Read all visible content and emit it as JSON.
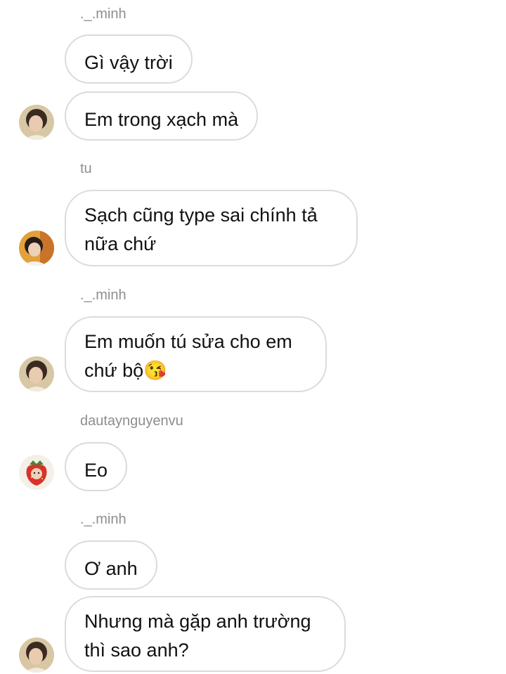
{
  "thread": {
    "messages": [
      {
        "sender": "._.minh",
        "text": "Gì vậy trời"
      },
      {
        "text": "Em trong xạch mà"
      },
      {
        "sender": "tu",
        "text": "Sạch cũng type sai chính tả nữa chứ"
      },
      {
        "sender": "._.minh",
        "text": "Em muốn tú sửa cho em chứ bộ😘"
      },
      {
        "sender": "dautaynguyenvu",
        "text": "Eo"
      },
      {
        "sender": "._.minh",
        "text": "Ơ anh"
      },
      {
        "text": "Nhưng mà gặp anh trường thì sao anh?"
      }
    ]
  },
  "avatars": {
    "minh": {
      "icon": "minh-avatar-icon"
    },
    "tu": {
      "icon": "tu-avatar-icon"
    },
    "dautay": {
      "icon": "strawberry-avatar-icon"
    }
  },
  "colors": {
    "background": "#ffffff",
    "bubble_border": "#dbdbdb",
    "sender_text": "#8e8e8e",
    "message_text": "#111111"
  }
}
